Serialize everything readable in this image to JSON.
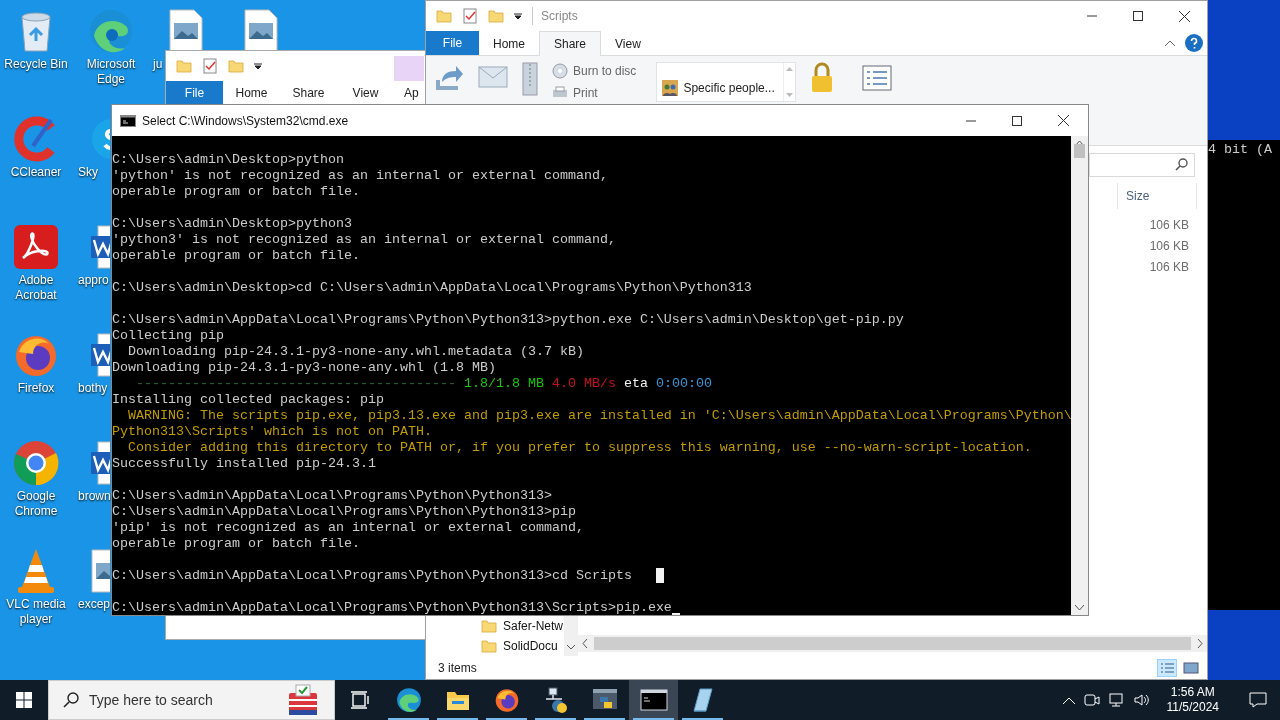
{
  "desktop": {
    "columns": [
      [
        {
          "label": "Recycle Bin",
          "kind": "recycle"
        },
        {
          "label": "CCleaner",
          "kind": "ccleaner"
        },
        {
          "label": "Adobe Acrobat",
          "kind": "acrobat"
        },
        {
          "label": "Firefox",
          "kind": "firefox"
        },
        {
          "label": "Google Chrome",
          "kind": "chrome"
        },
        {
          "label": "VLC media player",
          "kind": "vlc"
        }
      ],
      [
        {
          "label": "Microsoft Edge",
          "kind": "edge"
        },
        {
          "label": "Sky",
          "kind": "skype"
        },
        {
          "label": "appro",
          "kind": "word"
        },
        {
          "label": "bothy",
          "kind": "word"
        },
        {
          "label": "brown",
          "kind": "word"
        },
        {
          "label": "excep",
          "kind": "image"
        }
      ],
      [
        {
          "label": "ju",
          "kind": "image"
        }
      ],
      [
        {
          "kind": "image"
        }
      ]
    ]
  },
  "back_explorer": {
    "tabs": [
      {
        "label": "File",
        "kind": "file"
      },
      {
        "label": "Home",
        "kind": "tab"
      },
      {
        "label": "Share",
        "kind": "tab"
      },
      {
        "label": "View",
        "kind": "tab"
      },
      {
        "label": "Ap",
        "kind": "contextual"
      }
    ]
  },
  "explorer": {
    "title": "Scripts",
    "tabs": [
      {
        "label": "File",
        "kind": "file",
        "selected": false
      },
      {
        "label": "Home",
        "kind": "tab",
        "selected": false
      },
      {
        "label": "Share",
        "kind": "tab",
        "selected": true
      },
      {
        "label": "View",
        "kind": "tab",
        "selected": false
      }
    ],
    "small_actions": [
      {
        "label": "Burn to disc",
        "kind": "disc"
      },
      {
        "label": "Print",
        "kind": "print"
      }
    ],
    "share_with": "Specific people...",
    "size_header": "Size",
    "sizes": [
      "106 KB",
      "106 KB",
      "106 KB"
    ],
    "nav_items": [
      "Safer-Netw",
      "SolidDocu"
    ],
    "status": "3 items"
  },
  "back_console": {
    "text": "4 bit (A"
  },
  "console": {
    "title": "Select C:\\Windows\\System32\\cmd.exe",
    "lines": [
      {
        "kind": "plain",
        "text": "C:\\Users\\admin\\Desktop>python"
      },
      {
        "kind": "plain",
        "text": "'python' is not recognized as an internal or external command,"
      },
      {
        "kind": "plain",
        "text": "operable program or batch file."
      },
      {
        "kind": "blank"
      },
      {
        "kind": "plain",
        "text": "C:\\Users\\admin\\Desktop>python3"
      },
      {
        "kind": "plain",
        "text": "'python3' is not recognized as an internal or external command,"
      },
      {
        "kind": "plain",
        "text": "operable program or batch file."
      },
      {
        "kind": "blank"
      },
      {
        "kind": "plain",
        "text": "C:\\Users\\admin\\Desktop>cd C:\\Users\\admin\\AppData\\Local\\Programs\\Python\\Python313"
      },
      {
        "kind": "blank"
      },
      {
        "kind": "plain",
        "text": "C:\\Users\\admin\\AppData\\Local\\Programs\\Python\\Python313>python.exe C:\\Users\\admin\\Desktop\\get-pip.py"
      },
      {
        "kind": "plain",
        "text": "Collecting pip"
      },
      {
        "kind": "plain",
        "text": "  Downloading pip-24.3.1-py3-none-any.whl.metadata (3.7 kB)"
      },
      {
        "kind": "plain",
        "text": "Downloading pip-24.3.1-py3-none-any.whl (1.8 MB)"
      },
      {
        "kind": "progress",
        "spans": [
          {
            "text": "----------------------------------------",
            "color": "#2a6b2a"
          },
          {
            "text": "1.8/1.8 MB",
            "color": "#16c60c"
          },
          {
            "text": "4.0 MB/s",
            "color": "#c50f1f"
          },
          {
            "text": "eta",
            "color": "#f2f2f2"
          },
          {
            "text": "0:00:00",
            "color": "#3a96dd"
          }
        ]
      },
      {
        "kind": "plain",
        "text": "Installing collected packages: pip"
      },
      {
        "kind": "warning",
        "text": "  WARNING: The scripts pip.exe, pip3.13.exe and pip3.exe are installed in 'C:\\Users\\admin\\AppData\\Local\\Programs\\Python\\"
      },
      {
        "kind": "warning",
        "text": "Python313\\Scripts' which is not on PATH."
      },
      {
        "kind": "warning",
        "text": "  Consider adding this directory to PATH or, if you prefer to suppress this warning, use --no-warn-script-location."
      },
      {
        "kind": "plain",
        "text": "Successfully installed pip-24.3.1"
      },
      {
        "kind": "blank"
      },
      {
        "kind": "plain",
        "text": "C:\\Users\\admin\\AppData\\Local\\Programs\\Python\\Python313>"
      },
      {
        "kind": "plain",
        "text": "C:\\Users\\admin\\AppData\\Local\\Programs\\Python\\Python313>pip"
      },
      {
        "kind": "plain",
        "text": "'pip' is not recognized as an internal or external command,"
      },
      {
        "kind": "plain",
        "text": "operable program or batch file."
      },
      {
        "kind": "blank"
      },
      {
        "kind": "plain",
        "text": "C:\\Users\\admin\\AppData\\Local\\Programs\\Python\\Python313>cd Scripts",
        "block_cursor": true
      },
      {
        "kind": "blank"
      },
      {
        "kind": "plain",
        "text": "C:\\Users\\admin\\AppData\\Local\\Programs\\Python\\Python313\\Scripts>pip.exe",
        "underline_cursor": true
      }
    ]
  },
  "taskbar": {
    "search_placeholder": "Type here to search",
    "apps": [
      {
        "kind": "taskview",
        "running": false,
        "active": false
      },
      {
        "kind": "edge",
        "running": true,
        "active": false
      },
      {
        "kind": "explorer",
        "running": true,
        "active": false
      },
      {
        "kind": "firefox",
        "running": true,
        "active": false
      },
      {
        "kind": "pyapp",
        "running": true,
        "active": false
      },
      {
        "kind": "python",
        "running": true,
        "active": false
      },
      {
        "kind": "cmd",
        "running": true,
        "active": true
      },
      {
        "kind": "notepad",
        "running": true,
        "active": false
      }
    ],
    "time": "1:56 AM",
    "date": "11/5/2024"
  }
}
